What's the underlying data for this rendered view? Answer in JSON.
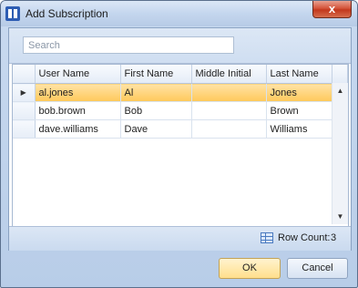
{
  "window": {
    "title": "Add Subscription",
    "close_label": "x"
  },
  "search": {
    "placeholder": "Search",
    "value": ""
  },
  "grid": {
    "columns": [
      "User Name",
      "First Name",
      "Middle Initial",
      "Last Name"
    ],
    "current_row_marker": "▶",
    "rows": [
      {
        "user_name": "al.jones",
        "first_name": "Al",
        "middle_initial": "",
        "last_name": "Jones",
        "selected": true
      },
      {
        "user_name": "bob.brown",
        "first_name": "Bob",
        "middle_initial": "",
        "last_name": "Brown",
        "selected": false
      },
      {
        "user_name": "dave.williams",
        "first_name": "Dave",
        "middle_initial": "",
        "last_name": "Williams",
        "selected": false
      }
    ],
    "scroll_up": "▲",
    "scroll_down": "▼"
  },
  "footer": {
    "row_count_label": "Row Count:",
    "row_count_value": "3",
    "icon": "grid-icon"
  },
  "buttons": {
    "ok": "OK",
    "cancel": "Cancel"
  },
  "colors": {
    "selected_row": "#ffc85a",
    "title_bar": "#c4d6ee",
    "close_button": "#c2381d"
  }
}
